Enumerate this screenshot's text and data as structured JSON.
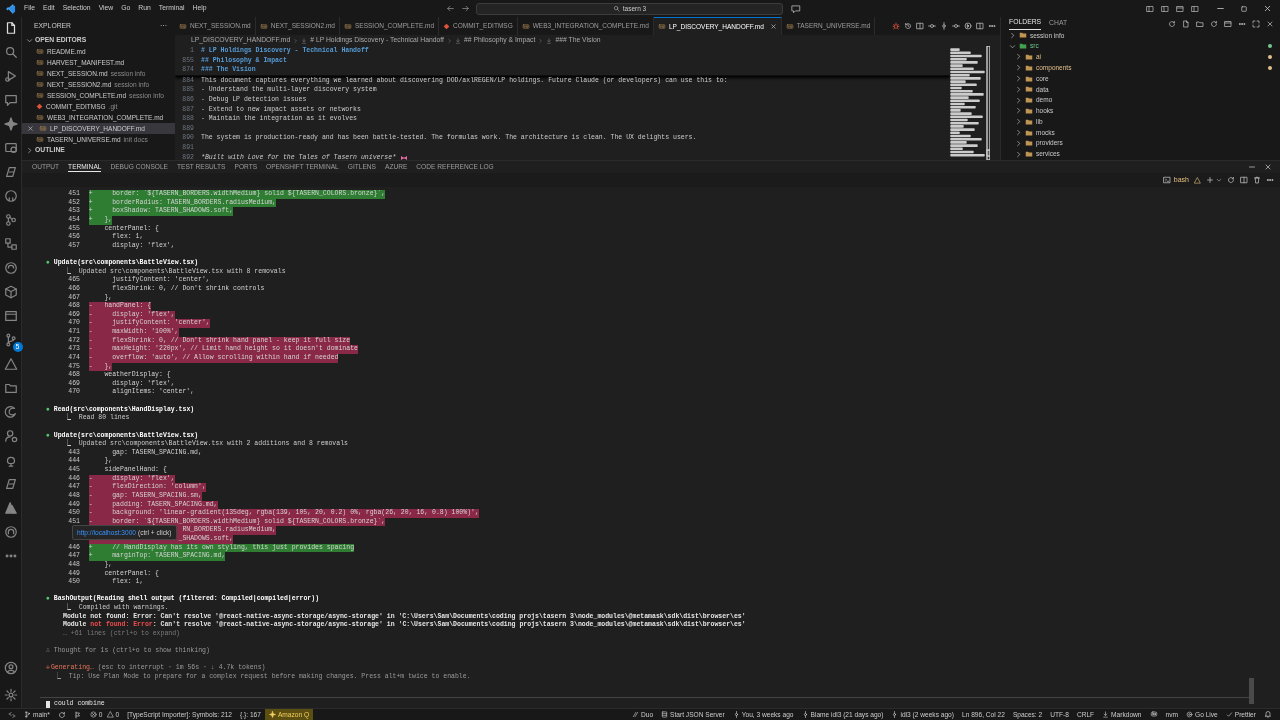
{
  "menu": [
    "File",
    "Edit",
    "Selection",
    "View",
    "Go",
    "Run",
    "Terminal",
    "Help"
  ],
  "search": {
    "value": "tasern 3"
  },
  "activity_bar": {
    "badge": "5"
  },
  "explorer": {
    "title": "EXPLORER",
    "more": "···",
    "sections": [
      {
        "title": "OPEN EDITORS",
        "expanded": true,
        "items": [
          {
            "name": "README.md",
            "kind": "markdown",
            "selected": false
          },
          {
            "name": "HARVEST_MANIFEST.md",
            "kind": "markdown",
            "selected": false
          },
          {
            "name": "NEXT_SESSION.md",
            "kind": "markdown",
            "description": "session info",
            "selected": false
          },
          {
            "name": "NEXT_SESSION2.md",
            "kind": "markdown",
            "description": "session info",
            "selected": false
          },
          {
            "name": "SESSION_COMPLETE.md",
            "kind": "markdown",
            "description": "session info",
            "selected": false
          },
          {
            "name": "COMMIT_EDITMSG",
            "kind": "git",
            "description": ".git",
            "selected": false
          },
          {
            "name": "WEB3_INTEGRATION_COMPLETE.md",
            "kind": "markdown",
            "selected": false
          },
          {
            "name": "LP_DISCOVERY_HANDOFF.md",
            "kind": "markdown",
            "selected": true
          },
          {
            "name": "TASERN_UNIVERSE.md",
            "kind": "markdown",
            "description": "init docs",
            "selected": false
          }
        ]
      },
      {
        "title": "OUTLINE",
        "expanded": false
      }
    ]
  },
  "editor_tabs": [
    {
      "label": "NEXT_SESSION.md",
      "kind": "markdown",
      "selected": false
    },
    {
      "label": "NEXT_SESSION2.md",
      "kind": "markdown",
      "selected": false
    },
    {
      "label": "SESSION_COMPLETE.md",
      "kind": "markdown",
      "selected": false
    },
    {
      "label": "COMMIT_EDITMSG",
      "kind": "git",
      "selected": false
    },
    {
      "label": "WEB3_INTEGRATION_COMPLETE.md",
      "kind": "markdown",
      "selected": false
    },
    {
      "label": "LP_DISCOVERY_HANDOFF.md",
      "kind": "markdown",
      "selected": true
    },
    {
      "label": "TASERN_UNIVERSE.md",
      "kind": "markdown",
      "selected": false
    }
  ],
  "breadcrumbs": [
    "LP_DISCOVERY_HANDOFF.md",
    "# LP Holdings Discovery - Technical Handoff",
    "## Philosophy & Impact",
    "### The Vision"
  ],
  "editor": {
    "sticky": [
      {
        "num": "1",
        "text": "# LP Holdings Discovery - Technical Handoff"
      },
      {
        "num": "855",
        "text": "## Philosophy & Impact"
      },
      {
        "num": "874",
        "text": "### The Vision"
      }
    ],
    "lines": [
      {
        "num": "884",
        "text": "This document captures everything we learned about discovering DOD/axlREGEN/LP holdings. Future Claude (or developers) can use this to:"
      },
      {
        "num": "885",
        "text": "- Understand the multi-layer discovery system"
      },
      {
        "num": "886",
        "text": "- Debug LP detection issues"
      },
      {
        "num": "887",
        "text": "- Extend to new impact assets or networks"
      },
      {
        "num": "888",
        "text": "- Maintain the integration as it evolves"
      },
      {
        "num": "889"
      },
      {
        "num": "890",
        "text": "The system is production-ready and has been battle-tested. The formulas work. The architecture is clean. The UX delights users."
      },
      {
        "num": "891"
      },
      {
        "num": "892",
        "text": "*Built with Love for the Tales of Tasern universe*",
        "kind": "emphasis"
      }
    ]
  },
  "folders": {
    "tabs": [
      {
        "label": "FOLDERS",
        "selected": true
      },
      {
        "label": "CHAT",
        "selected": false
      }
    ],
    "tree": [
      {
        "label": "session info",
        "expanded": false
      },
      {
        "label": "src",
        "expanded": true,
        "color": "#73c991",
        "children": [
          {
            "label": "ai",
            "expanded": false,
            "color": "#e2c08d"
          },
          {
            "label": "components",
            "expanded": false,
            "color": "#e2c08d"
          },
          {
            "label": "core",
            "expanded": false
          },
          {
            "label": "data",
            "expanded": false
          },
          {
            "label": "demo",
            "expanded": false
          },
          {
            "label": "hooks",
            "expanded": false
          },
          {
            "label": "lib",
            "expanded": false
          },
          {
            "label": "mocks",
            "expanded": false
          },
          {
            "label": "providers",
            "expanded": false
          },
          {
            "label": "services",
            "expanded": false
          }
        ]
      }
    ]
  },
  "panel": {
    "tabs": [
      {
        "label": "OUTPUT",
        "selected": false
      },
      {
        "label": "TERMINAL",
        "selected": true
      },
      {
        "label": "DEBUG CONSOLE",
        "selected": false
      },
      {
        "label": "TEST RESULTS",
        "selected": false
      },
      {
        "label": "PORTS",
        "selected": false
      },
      {
        "label": "OPENSHIFT TERMINAL",
        "selected": false
      },
      {
        "label": "GITLENS",
        "selected": false
      },
      {
        "label": "AZURE",
        "selected": false
      },
      {
        "label": "CODE REFERENCE LOG",
        "selected": false
      }
    ],
    "terminal": {
      "shell": "bash",
      "blocks": [
        [
          {
            "kind": "add",
            "num": "451",
            "marker": "+",
            "text": "    border: `${TASERN_BORDERS.widthMedium} solid ${TASERN_COLORS.bronze}`,"
          },
          {
            "kind": "add",
            "num": "452",
            "marker": "+",
            "text": "    borderRadius: TASERN_BORDERS.radiusMedium,"
          },
          {
            "kind": "add",
            "num": "453",
            "marker": "+",
            "text": "    boxShadow: TASERN_SHADOWS.soft,"
          },
          {
            "kind": "add",
            "num": "454",
            "marker": "+",
            "text": "  },"
          },
          {
            "kind": "ctx",
            "num": "455",
            "text": "  centerPanel: {"
          },
          {
            "kind": "ctx",
            "num": "456",
            "text": "    flex: 1,"
          },
          {
            "kind": "ctx",
            "num": "457",
            "text": "    display: 'flex',"
          }
        ],
        [
          {
            "kind": "header",
            "bullet": "●",
            "text": "Update(src\\components\\BattleView.tsx)"
          },
          {
            "kind": "sub",
            "text": "⎿  Updated src\\components\\BattleView.tsx with 8 removals"
          },
          {
            "kind": "ctx",
            "num": "465",
            "text": "    justifyContent: 'center',"
          },
          {
            "kind": "ctx",
            "num": "466",
            "text": "    flexShrink: 0, // Don't shrink controls"
          },
          {
            "kind": "ctx",
            "num": "467",
            "text": "  },"
          },
          {
            "kind": "del",
            "num": "468",
            "marker": "-",
            "text": "  handPanel: {"
          },
          {
            "kind": "del",
            "num": "469",
            "marker": "-",
            "text": "    display: 'flex',"
          },
          {
            "kind": "del",
            "num": "470",
            "marker": "-",
            "text": "    justifyContent: 'center',"
          },
          {
            "kind": "del",
            "num": "471",
            "marker": "-",
            "text": "    maxWidth: '100%',"
          },
          {
            "kind": "del",
            "num": "472",
            "marker": "-",
            "text": "    flexShrink: 0, // Don't shrink hand panel - keep it full size"
          },
          {
            "kind": "del",
            "num": "473",
            "marker": "-",
            "text": "    maxHeight: '220px', // Limit hand height so it doesn't dominate"
          },
          {
            "kind": "del",
            "num": "474",
            "marker": "-",
            "text": "    overflow: 'auto', // Allow scrolling within hand if needed"
          },
          {
            "kind": "del",
            "num": "475",
            "marker": "-",
            "text": "  },"
          },
          {
            "kind": "ctx",
            "num": "468",
            "text": "  weatherDisplay: {"
          },
          {
            "kind": "ctx",
            "num": "469",
            "text": "    display: 'flex',"
          },
          {
            "kind": "ctx",
            "num": "470",
            "text": "    alignItems: 'center',"
          }
        ],
        [
          {
            "kind": "header",
            "bullet": "●",
            "text": "Read(src\\components\\HandDisplay.tsx)"
          },
          {
            "kind": "sub",
            "text": "⎿  Read 80 lines"
          }
        ],
        [
          {
            "kind": "header",
            "bullet": "●",
            "text": "Update(src\\components\\BattleView.tsx)"
          },
          {
            "kind": "sub",
            "text": "⎿  Updated src\\components\\BattleView.tsx with 2 additions and 8 removals"
          },
          {
            "kind": "ctx",
            "num": "443",
            "text": "    gap: TASERN_SPACING.md,"
          },
          {
            "kind": "ctx",
            "num": "444",
            "text": "  },"
          },
          {
            "kind": "ctx",
            "num": "445",
            "text": "  sidePanelHand: {"
          },
          {
            "kind": "del",
            "num": "446",
            "marker": "-",
            "text": "    display: 'flex',"
          },
          {
            "kind": "del",
            "num": "447",
            "marker": "-",
            "text": "    flexDirection: 'column',"
          },
          {
            "kind": "del",
            "num": "448",
            "marker": "-",
            "text": "    gap: TASERN_SPACING.sm,"
          },
          {
            "kind": "del",
            "num": "449",
            "marker": "-",
            "text": "    padding: TASERN_SPACING.md,"
          },
          {
            "kind": "del",
            "num": "450",
            "marker": "-",
            "text": "    background: 'linear-gradient(135deg, rgba(139, 105, 20, 0.2) 0%, rgba(26, 20, 16, 0.8) 100%)',"
          },
          {
            "kind": "del",
            "num": "451",
            "marker": "-",
            "text": "    border: `${TASERN_BORDERS.widthMedium} solid ${TASERN_COLORS.bronze}`,"
          },
          {
            "kind": "del",
            "text": "                      RN_BORDERS.radiusMedium,",
            "tooltip": {
              "link": "http://localhost:3000",
              "hint": "(ctrl + click)"
            }
          },
          {
            "kind": "del",
            "text": "                     _SHADOWS.soft,"
          },
          {
            "kind": "add",
            "num": "446",
            "marker": "+",
            "text": "    // HandDisplay has its own styling, this just provides spacing"
          },
          {
            "kind": "add",
            "num": "447",
            "marker": "+",
            "text": "    marginTop: TASERN_SPACING.md,"
          },
          {
            "kind": "ctx",
            "num": "448",
            "text": "  },"
          },
          {
            "kind": "ctx",
            "num": "449",
            "text": "  centerPanel: {"
          },
          {
            "kind": "ctx",
            "num": "450",
            "text": "    flex: 1,"
          }
        ],
        [
          {
            "kind": "header",
            "bullet": "●",
            "text": "BashOutput(Reading shell output (filtered: Compiled|compiled|error))"
          },
          {
            "kind": "sub",
            "text": "⎿  Compiled with warnings."
          },
          {
            "kind": "out",
            "parts": [
              {
                "text": "Module not found: Error: Can't resolve '@react-native-async-storage/async-storage' in 'C:\\Users\\Sam\\Documents\\coding projs\\tasern 3\\node_modules\\@metamask\\sdk\\dist\\browser\\es'",
                "alert": false
              }
            ]
          },
          {
            "kind": "out",
            "parts": [
              {
                "text": "Module ",
                "alert": false
              },
              {
                "text": "not found: Error",
                "alert": true
              },
              {
                "text": ": Can't resolve '@react-native-async-storage/async-storage' in 'C:\\Users\\Sam\\Documents\\coding projs\\tasern 3\\node_modules\\@metamask\\sdk\\dist\\browser\\es'",
                "alert": false
              }
            ]
          },
          {
            "kind": "dim",
            "text": "… +61 lines (ctrl+o to expand)"
          }
        ],
        [
          {
            "kind": "note",
            "text": "∴ Thought for 1s (ctrl+o to show thinking)"
          }
        ],
        [
          {
            "kind": "status",
            "glyph": "✢",
            "label": "Generating…",
            "detail": "(esc to interrupt · 1m 56s · ↓ 4.7k tokens)"
          },
          {
            "kind": "tip",
            "text": "⎿  Tip: Use Plan Mode to prepare for a complex request before making changes. Press alt+m twice to enable."
          }
        ]
      ],
      "prompt": "could combine"
    }
  },
  "status_bar": {
    "left": [
      {
        "kind": "remote"
      },
      {
        "kind": "branch",
        "text": "main*"
      },
      {
        "kind": "sync"
      },
      {
        "kind": "ports"
      },
      {
        "kind": "problems",
        "errors": "0",
        "warnings": "0"
      },
      {
        "kind": "text",
        "text": "[TypeScript Importer]: Symbols: 212"
      },
      {
        "kind": "text",
        "text": "{.}: 167"
      },
      {
        "kind": "highlight",
        "text": "Amazon Q"
      }
    ],
    "right": [
      {
        "kind": "duo",
        "text": "Duo"
      },
      {
        "kind": "server",
        "text": "Start JSON Server"
      },
      {
        "kind": "commit",
        "text": "You, 3 weeks ago"
      },
      {
        "kind": "commit",
        "text": "Blame idl3 (21 days ago)"
      },
      {
        "kind": "commit",
        "text": "idl3 (2 weeks ago)"
      },
      {
        "kind": "text",
        "text": "Ln 896, Col 22"
      },
      {
        "kind": "text",
        "text": "Spaces: 2"
      },
      {
        "kind": "text",
        "text": "UTF-8"
      },
      {
        "kind": "text",
        "text": "CRLF"
      },
      {
        "kind": "language",
        "text": "Markdown"
      },
      {
        "kind": "copilot"
      },
      {
        "kind": "text",
        "text": "nvm"
      },
      {
        "kind": "live",
        "text": "Go Live"
      },
      {
        "kind": "check",
        "text": "Prettier"
      },
      {
        "kind": "bell"
      }
    ]
  }
}
